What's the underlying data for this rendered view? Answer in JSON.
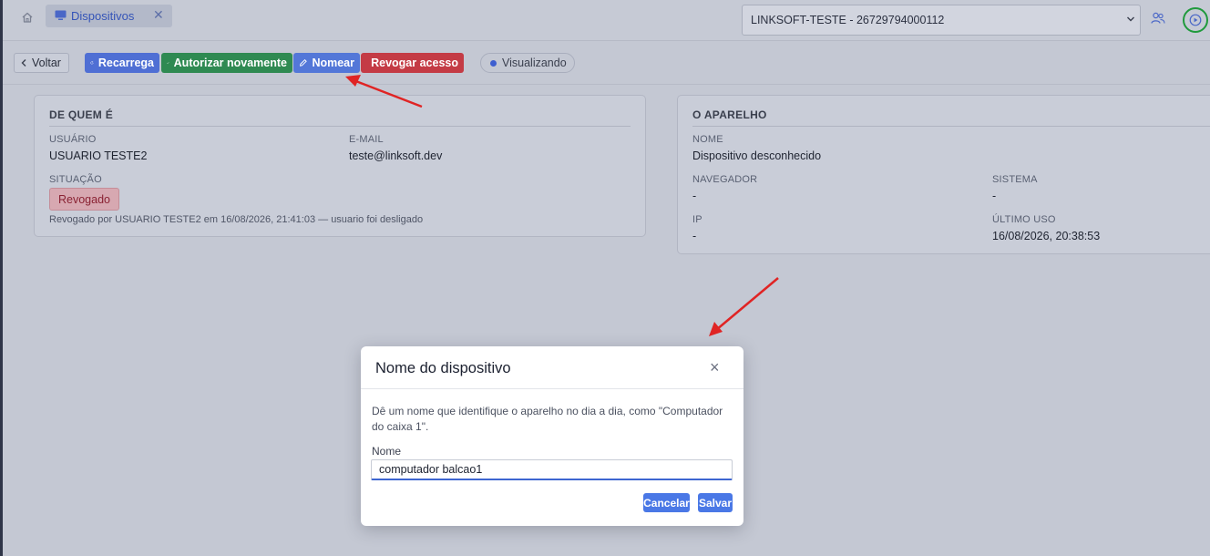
{
  "tabs": [
    {
      "label": "Dispositivos",
      "close": "✕"
    }
  ],
  "tenant": {
    "selected": "LINKSOFT-TESTE - 26729794000112"
  },
  "toolbar": {
    "back": "Voltar",
    "reload": "Recarrega",
    "authorize": "Autorizar novamente",
    "name": "Nomear",
    "revoke": "Revogar acesso",
    "status": "Visualizando"
  },
  "owner_card": {
    "title": "DE QUEM É",
    "user_label": "USUÁRIO",
    "user_value": "USUARIO TESTE2",
    "email_label": "E-MAIL",
    "email_value": "teste@linksoft.dev",
    "status_label": "SITUAÇÃO",
    "status_value": "Revogado",
    "revoke_note": "Revogado por USUARIO TESTE2 em 16/08/2026, 21:41:03 — usuario foi desligado"
  },
  "device_card": {
    "title": "O APARELHO",
    "name_label": "NOME",
    "name_value": "Dispositivo desconhecido",
    "browser_label": "NAVEGADOR",
    "browser_value": "-",
    "system_label": "SISTEMA",
    "system_value": "-",
    "ip_label": "IP",
    "ip_value": "-",
    "last_use_label": "ÚLTIMO USO",
    "last_use_value": "16/08/2026, 20:38:53"
  },
  "modal": {
    "title": "Nome do dispositivo",
    "close": "×",
    "description": "Dê um nome que identifique o aparelho no dia a dia, como \"Computador do caixa 1\".",
    "field_label": "Nome",
    "field_value": "computador balcao1",
    "cancel": "Cancelar",
    "save": "Salvar"
  },
  "colors": {
    "primary": "#4a78e6",
    "success": "#2f8a52",
    "danger": "#c43b45",
    "annotation_arrow": "#e02424",
    "highlight_ring": "#1f9a3c"
  },
  "icons": [
    "home-icon",
    "monitor-icon",
    "chevron-down-icon",
    "users-icon",
    "play-circle-icon",
    "chevron-left-icon",
    "refresh-icon",
    "check-icon",
    "pencil-icon",
    "trash-icon",
    "close-icon"
  ]
}
